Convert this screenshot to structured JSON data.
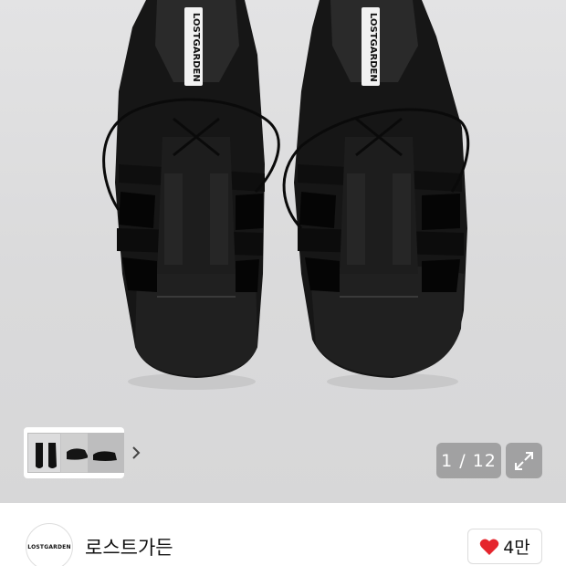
{
  "product_image": {
    "alt": "Black leather fisherman lace-up sandals",
    "label_left": "LOSTGARDEN",
    "label_right": "LOSTGARDEN"
  },
  "gallery": {
    "counter": "1 / 12",
    "next_icon": "chevron-right-icon",
    "expand_icon": "expand-icon"
  },
  "brand": {
    "logo_text": "LOSTGARDEN",
    "name": "로스트가든",
    "like_icon": "heart-icon",
    "like_count": "4만",
    "like_color": "#e5252d"
  }
}
